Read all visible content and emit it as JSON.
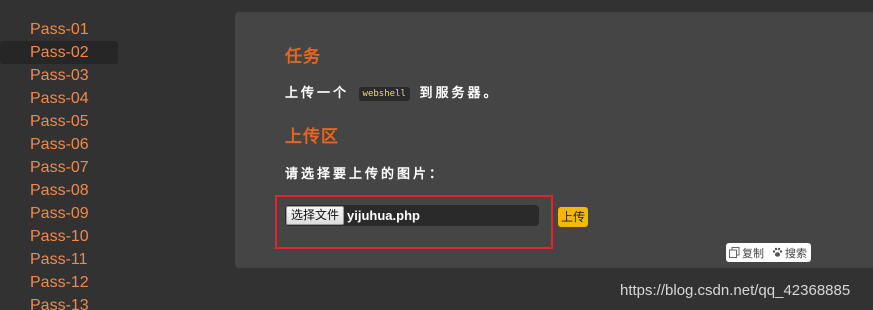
{
  "sidebar": {
    "items": [
      {
        "label": "Pass-01"
      },
      {
        "label": "Pass-02",
        "active": true
      },
      {
        "label": "Pass-03"
      },
      {
        "label": "Pass-04"
      },
      {
        "label": "Pass-05"
      },
      {
        "label": "Pass-06"
      },
      {
        "label": "Pass-07"
      },
      {
        "label": "Pass-08"
      },
      {
        "label": "Pass-09"
      },
      {
        "label": "Pass-10"
      },
      {
        "label": "Pass-11"
      },
      {
        "label": "Pass-12"
      },
      {
        "label": "Pass-13"
      }
    ]
  },
  "task": {
    "title": "任务",
    "desc_before": "上传一个",
    "code": "webshell",
    "desc_after": "到服务器。"
  },
  "upload": {
    "title": "上传区",
    "prompt": "请选择要上传的图片：",
    "choose_button": "选择文件",
    "file_name": "yijuhua.php",
    "submit_button": "上传"
  },
  "toolbar": {
    "copy_label": "复制",
    "search_label": "搜索",
    "copy_icon": "copy-icon",
    "search_icon": "paw-icon"
  },
  "watermark": "https://blog.csdn.net/qq_42368885",
  "colors": {
    "background": "#323232",
    "panel": "#454545",
    "accent_orange": "#e8651f",
    "sidebar_link": "#f08a4b",
    "highlight_red": "#e0252d",
    "upload_button": "#f5b800"
  }
}
